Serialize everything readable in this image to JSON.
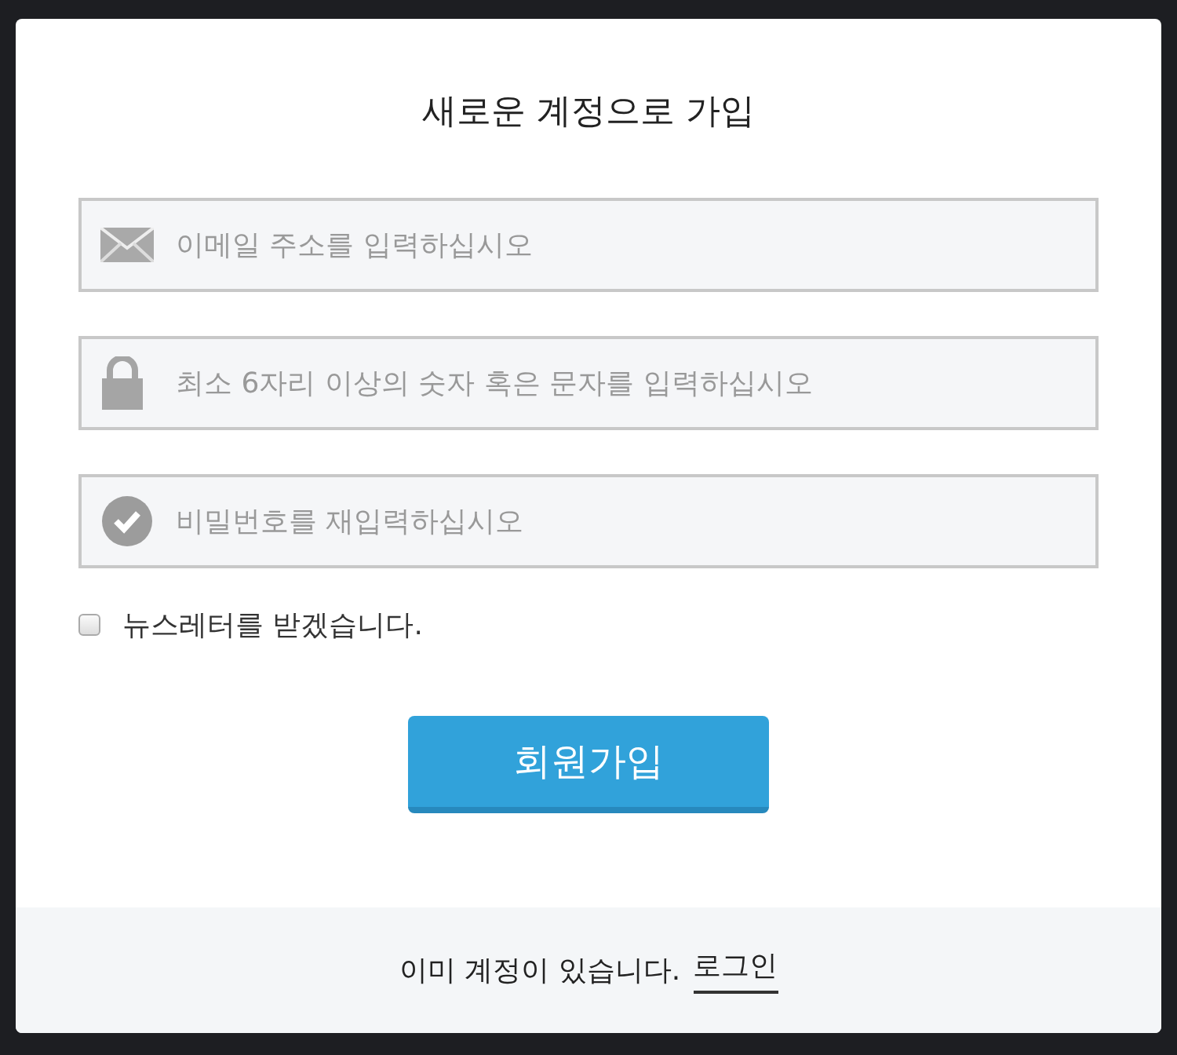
{
  "title": "새로운 계정으로 가입",
  "fields": [
    {
      "kind": "email",
      "placeholder": "이메일 주소를 입력하십시오"
    },
    {
      "kind": "password",
      "placeholder": "최소 6자리 이상의 숫자 혹은 문자를 입력하십시오"
    },
    {
      "kind": "confirm",
      "placeholder": "비밀번호를 재입력하십시오"
    }
  ],
  "newsletter": {
    "label": "뉴스레터를 받겠습니다.",
    "checked": false
  },
  "submit": "회원가입",
  "footer": {
    "text": "이미 계정이 있습니다.",
    "link": "로그인"
  }
}
